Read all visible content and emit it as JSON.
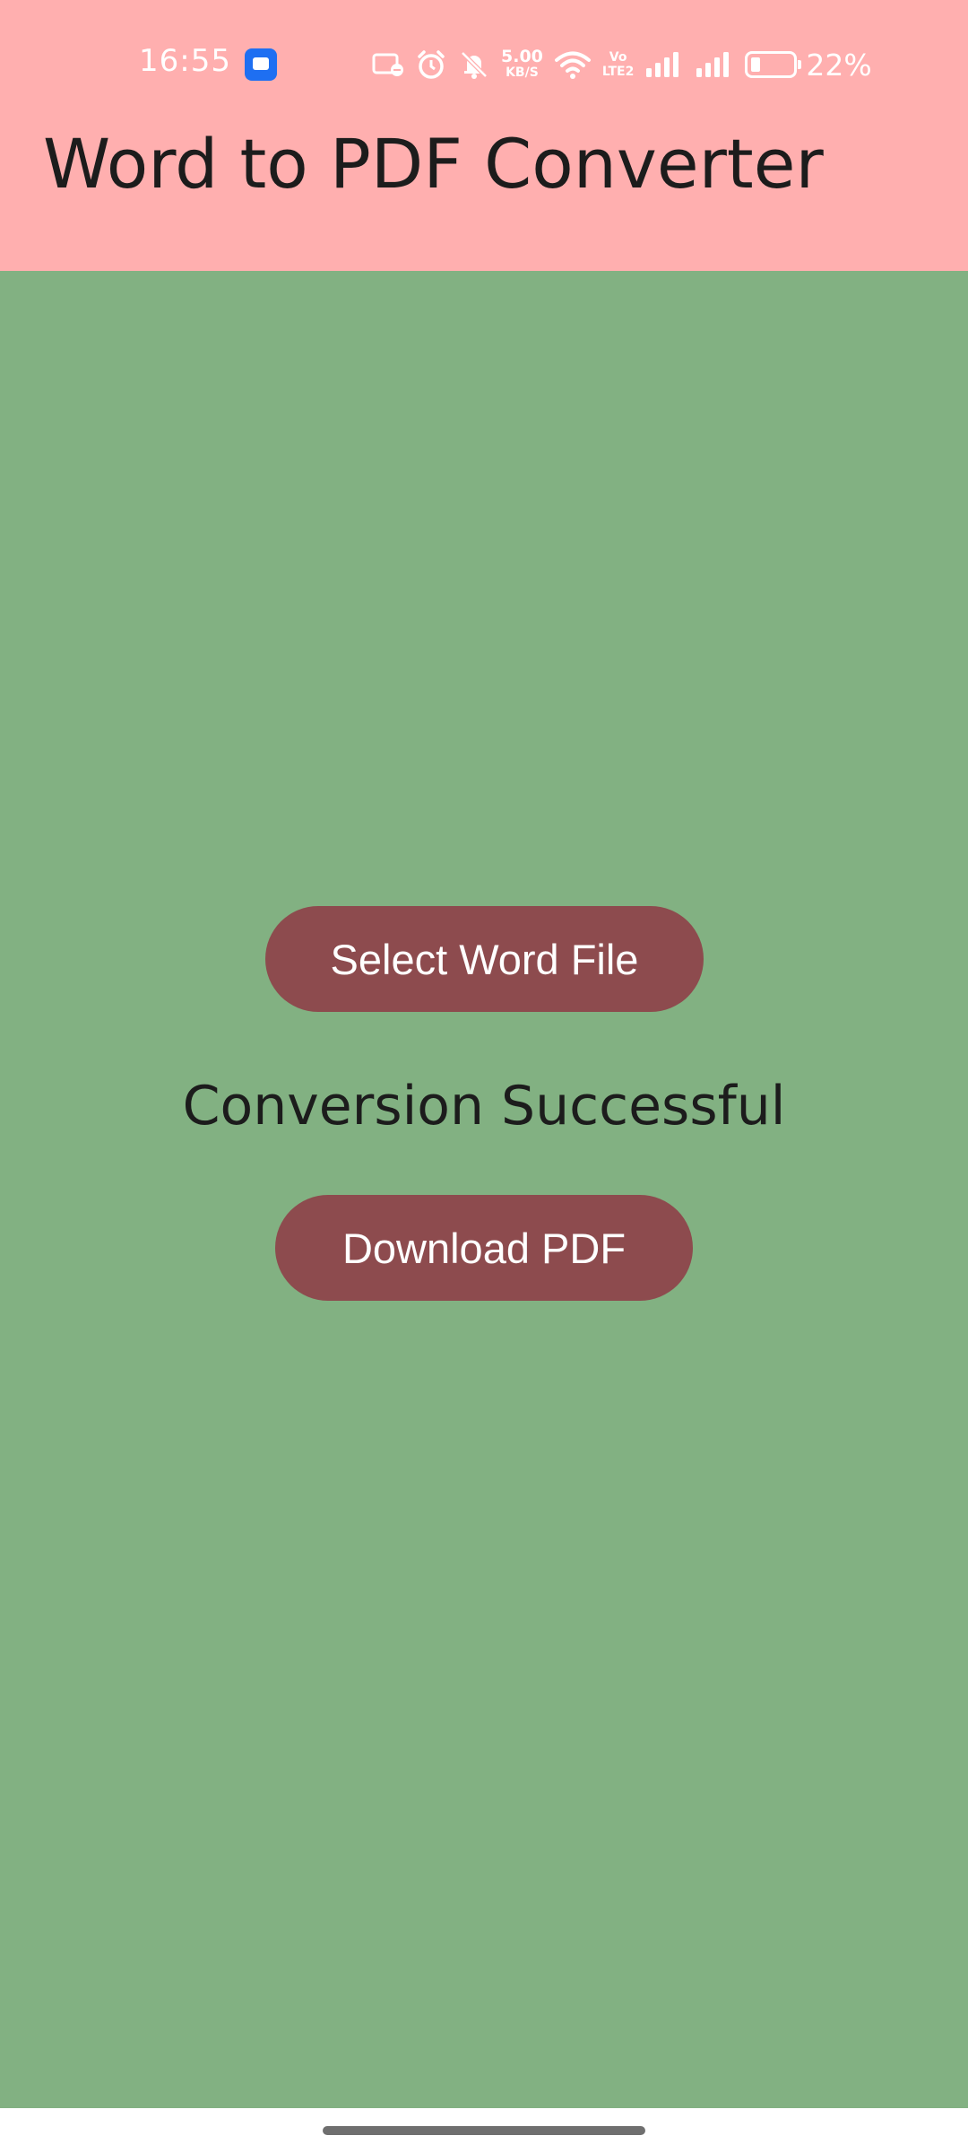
{
  "status_bar": {
    "time": "16:55",
    "network_speed_value": "5.00",
    "network_speed_unit": "KB/S",
    "volte_label_top": "Vo",
    "volte_label_bottom": "LTE2",
    "battery_percent": "22%",
    "battery_level": 0.22,
    "icons": [
      "app-notification-icon",
      "cast-icon",
      "alarm-icon",
      "bell-muted-icon",
      "wifi-icon",
      "signal-icon",
      "signal-icon",
      "battery-icon"
    ]
  },
  "app_bar": {
    "title": "Word to PDF Converter"
  },
  "main": {
    "select_button_label": "Select Word File",
    "status_message": "Conversion Successful",
    "download_button_label": "Download PDF"
  },
  "colors": {
    "app_bar_bg": "#ffafaf",
    "content_bg": "#82b182",
    "button_bg": "#8d4b4e",
    "button_text": "#ffffff",
    "title_text": "#1c1c1c"
  }
}
